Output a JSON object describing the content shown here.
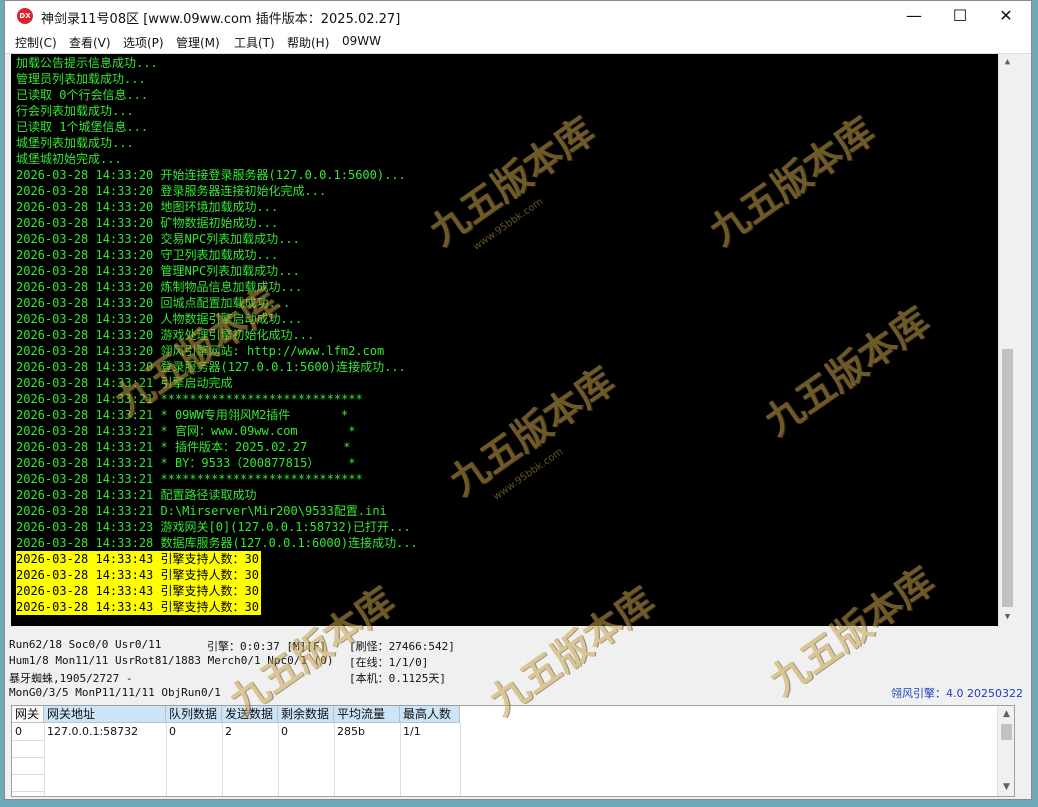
{
  "window": {
    "title": "神剑录11号08区 [www.09ww.com 插件版本：2025.02.27]",
    "icon_label": "DX",
    "minimize": "—",
    "maximize": "☐",
    "close": "✕"
  },
  "menu": [
    {
      "label": "控制(C)"
    },
    {
      "label": "查看(V)"
    },
    {
      "label": "选项(P)"
    },
    {
      "label": "管理(M)"
    },
    {
      "label": "工具(T)"
    },
    {
      "label": "帮助(H)"
    },
    {
      "label": "09WW"
    }
  ],
  "log": [
    {
      "text": "加载公告提示信息成功..."
    },
    {
      "text": "管理员列表加载成功..."
    },
    {
      "text": "已读取 0个行会信息..."
    },
    {
      "text": "行会列表加载成功..."
    },
    {
      "text": "已读取 1个城堡信息..."
    },
    {
      "text": "城堡列表加载成功..."
    },
    {
      "text": "城堡城初始完成..."
    },
    {
      "text": "2026-03-28 14:33:20 开始连接登录服务器(127.0.0.1:5600)..."
    },
    {
      "text": "2026-03-28 14:33:20 登录服务器连接初始化完成..."
    },
    {
      "text": "2026-03-28 14:33:20 地图环境加载成功..."
    },
    {
      "text": "2026-03-28 14:33:20 矿物数据初始成功..."
    },
    {
      "text": "2026-03-28 14:33:20 交易NPC列表加载成功..."
    },
    {
      "text": "2026-03-28 14:33:20 守卫列表加载成功..."
    },
    {
      "text": "2026-03-28 14:33:20 管理NPC列表加载成功..."
    },
    {
      "text": "2026-03-28 14:33:20 炼制物品信息加载成功..."
    },
    {
      "text": "2026-03-28 14:33:20 回城点配置加载成功..."
    },
    {
      "text": "2026-03-28 14:33:20 人物数据引擎启动成功..."
    },
    {
      "text": "2026-03-28 14:33:20 游戏处理引擎初始化成功..."
    },
    {
      "text": "2026-03-28 14:33:20 翎风引擎网站: http://www.lfm2.com"
    },
    {
      "text": "2026-03-28 14:33:20 登录服务器(127.0.0.1:5600)连接成功..."
    },
    {
      "text": "2026-03-28 14:33:21 引擎启动完成"
    },
    {
      "text": "2026-03-28 14:33:21 ****************************"
    },
    {
      "text": "2026-03-28 14:33:21 * 09WW专用翎风M2插件       *"
    },
    {
      "text": "2026-03-28 14:33:21 * 官网：www.09ww.com       *"
    },
    {
      "text": "2026-03-28 14:33:21 * 插件版本：2025.02.27     *"
    },
    {
      "text": "2026-03-28 14:33:21 * BY：9533（200877815）    *"
    },
    {
      "text": "2026-03-28 14:33:21 ****************************"
    },
    {
      "text": "2026-03-28 14:33:21 配置路径读取成功"
    },
    {
      "text": "2026-03-28 14:33:21 D:\\Mirserver\\Mir200\\9533配置.ini"
    },
    {
      "text": "2026-03-28 14:33:23 游戏网关[0](127.0.0.1:58732)已打开..."
    },
    {
      "text": "2026-03-28 14:33:28 数据库服务器(127.0.0.1:6000)连接成功..."
    },
    {
      "text": "2026-03-28 14:33:43 引擎支持人数：30",
      "highlight": true
    },
    {
      "text": "2026-03-28 14:33:43 引擎支持人数：30",
      "highlight": true
    },
    {
      "text": "2026-03-28 14:33:43 引擎支持人数：30",
      "highlight": true
    },
    {
      "text": "2026-03-28 14:33:43 引擎支持人数：30",
      "highlight": true
    }
  ],
  "status": {
    "run": "Run62/18 Soc0/0 Usr0/11",
    "engine": "引擎：0:0:37 [M][F]",
    "refresh": "[刷怪：27466:542]",
    "hum": "Hum1/8 Mon11/11 UsrRot81/1883 Merch0/1 Npc0/1 (0)",
    "online": "[在线：1/1/0]",
    "monster": "暴牙蜘蛛,1905/2727 -",
    "local": "[本机：0.1125天]",
    "mon_gen": "MonG0/3/5 MonP11/11/11 ObjRun0/1",
    "brand": "翎风引擎：4.0 20250322"
  },
  "gateway_table": {
    "headers": [
      "网关",
      "网关地址",
      "队列数据",
      "发送数据",
      "剩余数据",
      "平均流量",
      "最高人数"
    ],
    "rows": [
      [
        "0",
        "127.0.0.1:58732",
        "0",
        "2",
        "0",
        "285b",
        "1/1"
      ]
    ]
  },
  "watermark": {
    "text": "九五版本库",
    "url": "www.95bbk.com"
  }
}
